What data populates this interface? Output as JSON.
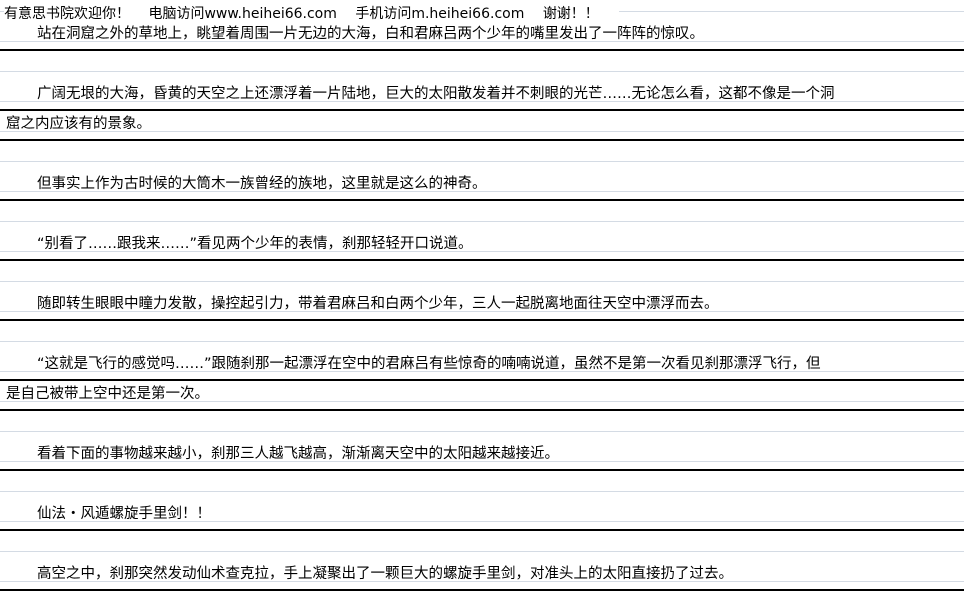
{
  "banner": {
    "site": "有意思书院欢迎你！",
    "pc": "电脑访问www.heihei66.com",
    "mobile": "手机访问m.heihei66.com",
    "thanks": "谢谢！！"
  },
  "paragraphs": [
    [
      "站在洞窟之外的草地上，眺望着周围一片无边的大海，白和君麻吕两个少年的嘴里发出了一阵阵的惊叹。"
    ],
    [
      "广阔无垠的大海，昏黄的天空之上还漂浮着一片陆地，巨大的太阳散发着并不刺眼的光芒……无论怎么看，这都不像是一个洞",
      "窟之内应该有的景象。"
    ],
    [
      "但事实上作为古时候的大筒木一族曾经的族地，这里就是这么的神奇。"
    ],
    [
      "“别看了……跟我来……”看见两个少年的表情，刹那轻轻开口说道。"
    ],
    [
      "随即转生眼眼中瞳力发散，操控起引力，带着君麻吕和白两个少年，三人一起脱离地面往天空中漂浮而去。"
    ],
    [
      "“这就是飞行的感觉吗……”跟随刹那一起漂浮在空中的君麻吕有些惊奇的喃喃说道，虽然不是第一次看见刹那漂浮飞行，但",
      "是自己被带上空中还是第一次。"
    ],
    [
      "看着下面的事物越来越小，刹那三人越飞越高，渐渐离天空中的太阳越来越接近。"
    ],
    [
      "仙法・风遁螺旋手里剑！！"
    ],
    [
      "高空之中，刹那突然发动仙术查克拉，手上凝聚出了一颗巨大的螺旋手里剑，对准头上的太阳直接扔了过去。"
    ]
  ]
}
